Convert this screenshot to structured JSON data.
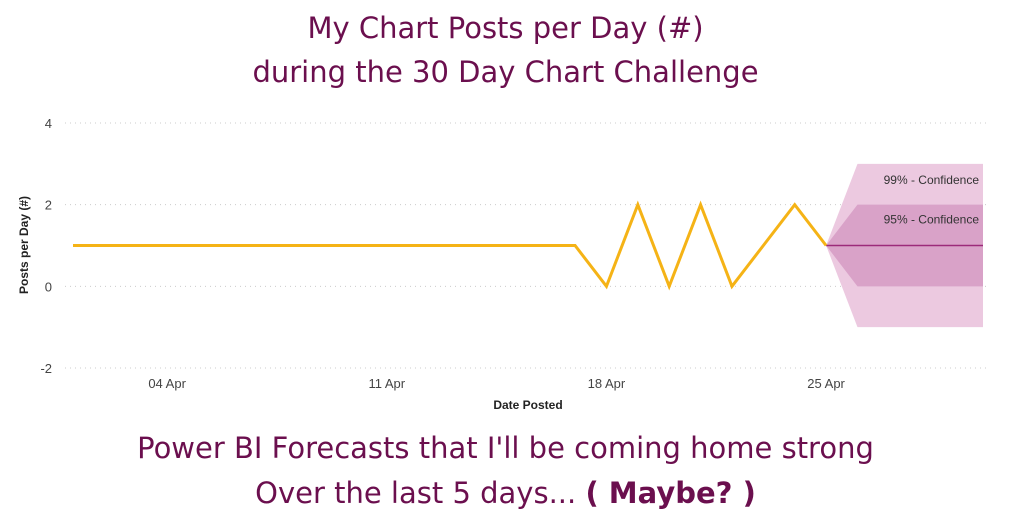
{
  "header": {
    "title_line1": "My Chart Posts per Day (#)",
    "title_line2": "during the 30 Day Chart Challenge"
  },
  "footer": {
    "line1": "Power BI Forecasts that I'll be coming home strong",
    "line2_prefix": "Over the last 5 days...",
    "line2_emphasis": "( Maybe? )"
  },
  "colors": {
    "title_text": "#6b0f4e",
    "actual_line": "#f5b316",
    "forecast_line": "#9c2a7a",
    "band_99": "#ecc9e0",
    "band_95": "#d9a2c8",
    "gridline": "#cccccc"
  },
  "chart_data": {
    "type": "line",
    "xlabel": "Date Posted",
    "ylabel": "Posts per Day (#)",
    "ylim": [
      -2,
      4
    ],
    "yticks": [
      -2,
      0,
      2,
      4
    ],
    "xlim": [
      "2021-04-01",
      "2021-04-30"
    ],
    "xticks": [
      {
        "date": "2021-04-04",
        "label": "04 Apr"
      },
      {
        "date": "2021-04-11",
        "label": "11 Apr"
      },
      {
        "date": "2021-04-18",
        "label": "18 Apr"
      },
      {
        "date": "2021-04-25",
        "label": "25 Apr"
      }
    ],
    "grid": true,
    "series": [
      {
        "x": [
          "2021-04-01",
          "2021-04-02",
          "2021-04-03",
          "2021-04-04",
          "2021-04-05",
          "2021-04-06",
          "2021-04-07",
          "2021-04-08",
          "2021-04-09",
          "2021-04-10",
          "2021-04-11",
          "2021-04-12",
          "2021-04-13",
          "2021-04-14",
          "2021-04-15",
          "2021-04-16",
          "2021-04-17",
          "2021-04-18",
          "2021-04-19",
          "2021-04-20",
          "2021-04-21",
          "2021-04-22",
          "2021-04-23",
          "2021-04-24",
          "2021-04-25"
        ],
        "values": [
          1,
          1,
          1,
          1,
          1,
          1,
          1,
          1,
          1,
          1,
          1,
          1,
          1,
          1,
          1,
          1,
          1,
          0,
          2,
          0,
          2,
          0,
          1,
          2,
          1
        ]
      }
    ],
    "forecast": {
      "x": [
        "2021-04-25",
        "2021-04-26",
        "2021-04-27",
        "2021-04-28",
        "2021-04-29",
        "2021-04-30"
      ],
      "values": [
        1,
        1,
        1,
        1,
        1,
        1
      ],
      "band_95_label": "95% - Confidence",
      "band_95": {
        "lower": [
          1,
          0,
          0,
          0,
          0,
          0
        ],
        "upper": [
          1,
          2,
          2,
          2,
          2,
          2
        ]
      },
      "band_99_label": "99% - Confidence",
      "band_99": {
        "lower": [
          1,
          -1,
          -1,
          -1,
          -1,
          -1
        ],
        "upper": [
          1,
          3,
          3,
          3,
          3,
          3
        ]
      }
    }
  }
}
